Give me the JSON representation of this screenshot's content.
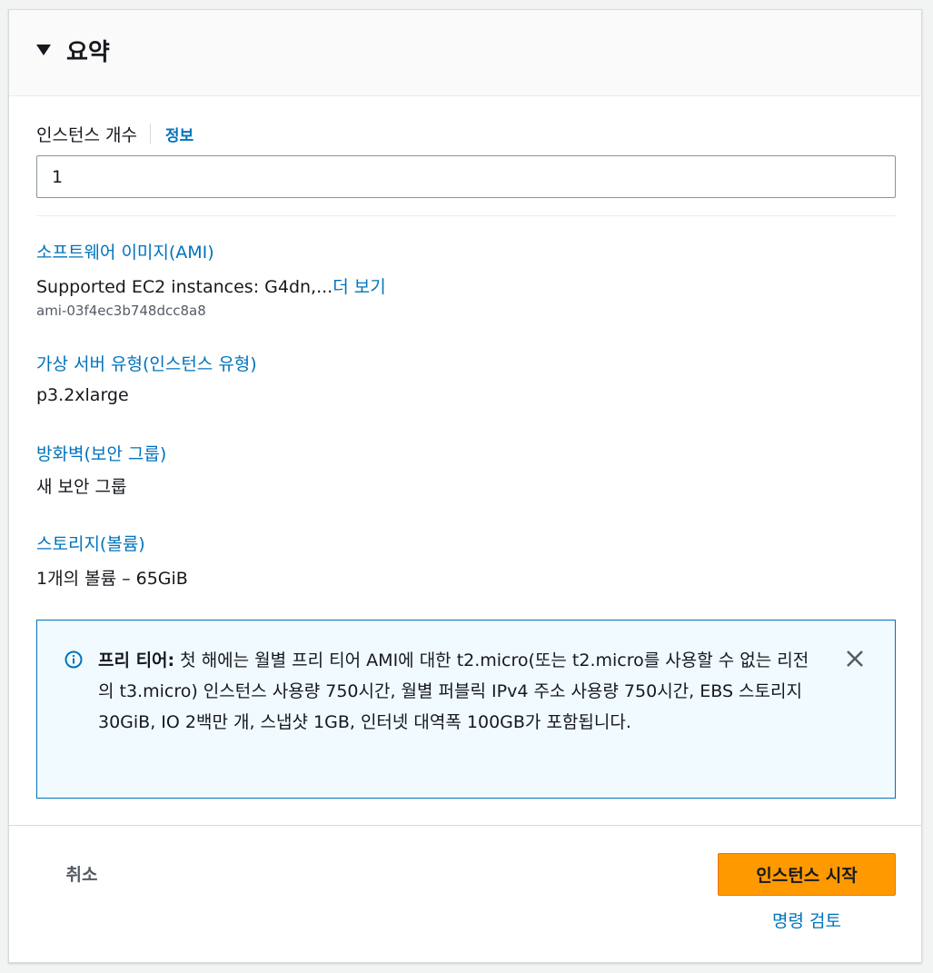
{
  "header": {
    "title": "요약",
    "caret_icon": "caret-down-icon"
  },
  "instance_count": {
    "label": "인스턴스 개수",
    "info_link": "정보",
    "value": "1"
  },
  "sections": {
    "ami": {
      "label": "소프트웨어 이미지(AMI)",
      "value": "Supported EC2 instances: G4dn,...",
      "more_link": "더 보기",
      "id": "ami-03f4ec3b748dcc8a8"
    },
    "instance_type": {
      "label": "가상 서버 유형(인스턴스 유형)",
      "value": "p3.2xlarge"
    },
    "firewall": {
      "label": "방화벽(보안 그룹)",
      "value": "새 보안 그룹"
    },
    "storage": {
      "label": "스토리지(볼륨)",
      "value": "1개의 볼륨 – 65GiB"
    }
  },
  "free_tier_alert": {
    "title": "프리 티어:",
    "text": " 첫 해에는 월별 프리 티어 AMI에 대한 t2.micro(또는 t2.micro를 사용할 수 없는 리전의 t3.micro) 인스턴스 사용량 750시간, 월별 퍼블릭 IPv4 주소 사용량 750시간, EBS 스토리지 30GiB, IO 2백만 개, 스냅샷 1GB, 인터넷 대역폭 100GB가 포함됩니다.",
    "info_icon": "info-circle-icon",
    "close_icon": "close-icon"
  },
  "footer": {
    "cancel_label": "취소",
    "launch_label": "인스턴스 시작",
    "review_label": "명령 검토"
  },
  "colors": {
    "link": "#0073bb",
    "primary_button": "#ff9900",
    "alert_bg": "#f1faff",
    "alert_border": "#0073bb"
  }
}
